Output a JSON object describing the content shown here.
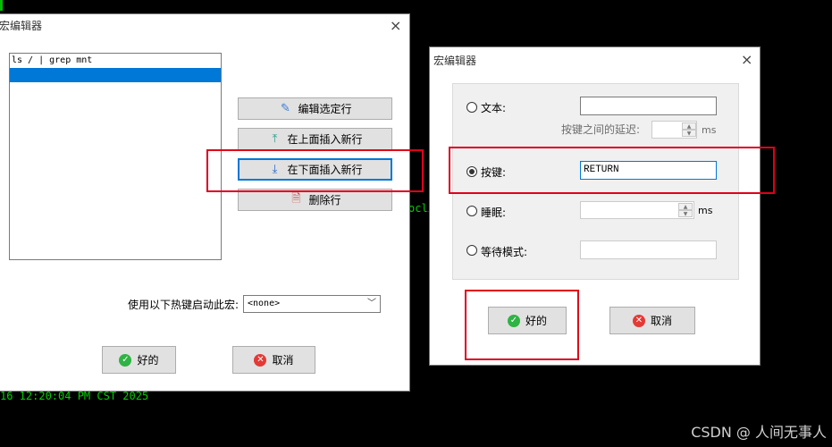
{
  "terminal": {
    "timestamp_line": "16 12:20:04 PM CST 2025",
    "fragment": "ocli"
  },
  "watermark": "CSDN @ 人间无事人",
  "macro_editor": {
    "title": "宏编辑器",
    "close_icon": "×",
    "lines": [
      "ls / | grep mnt",
      ""
    ],
    "buttons": {
      "edit": "编辑选定行",
      "insert_above": "在上面插入新行",
      "insert_below": "在下面插入新行",
      "delete": "删除行"
    },
    "hotkey_label": "使用以下热键启动此宏:",
    "hotkey_value": "<none>",
    "ok": "好的",
    "cancel": "取消"
  },
  "line_editor": {
    "title": "宏编辑器",
    "close_icon": "×",
    "text_label": "文本:",
    "text_value": "",
    "delay_label": "按键之间的延迟:",
    "delay_value": "",
    "delay_unit": "ms",
    "key_label": "按键:",
    "key_value": "RETURN",
    "sleep_label": "睡眠:",
    "sleep_value": "",
    "sleep_unit": "ms",
    "wait_label": "等待模式:",
    "wait_value": "",
    "selected_option": "按键",
    "ok": "好的",
    "cancel": "取消"
  },
  "icons": {
    "ok_icon": "check-circle-icon",
    "cancel_icon": "x-circle-icon",
    "edit_icon": "pencil-icon",
    "insert_above_icon": "arrow-up-to-line-icon",
    "insert_below_icon": "arrow-down-to-line-icon",
    "delete_icon": "delete-file-icon"
  },
  "colors": {
    "highlight_box": "#e0001a",
    "selection": "#0078d7",
    "terminal_text": "#00d000"
  }
}
